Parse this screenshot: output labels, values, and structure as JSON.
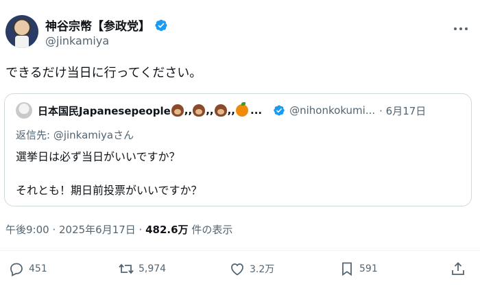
{
  "author": {
    "display_name": "神谷宗幣【参政党】",
    "handle": "@jinkamiya"
  },
  "tweet": {
    "text": "できるだけ当日に行ってください。"
  },
  "quote": {
    "name": "日本国民Japanesepeople",
    "name_separator": ",,",
    "ellipsis": "...",
    "handle": "@nihonkokumi...",
    "date": "· 6月17日",
    "reply_to": "返信先: @jinkamiyaさん",
    "line1": "選挙日は必ず当日がいいですか？",
    "line2": "それとも！期日前投票がいいですか？"
  },
  "meta": {
    "timestamp": "午後9:00 · 2025年6月17日 · ",
    "views_count": "482.6万",
    "views_label": " 件の表示"
  },
  "actions": {
    "replies": "451",
    "retweets": "5,974",
    "likes": "3.2万",
    "bookmarks": "591"
  },
  "colors": {
    "verified": "#1d9bf0",
    "secondary_text": "#536471",
    "border": "#cfd9de"
  },
  "icons": [
    "verified-badge-icon",
    "more-icon",
    "reply-icon",
    "retweet-icon",
    "like-icon",
    "bookmark-icon",
    "share-icon",
    "hedgehog-emoji-icon",
    "orange-emoji-icon"
  ]
}
